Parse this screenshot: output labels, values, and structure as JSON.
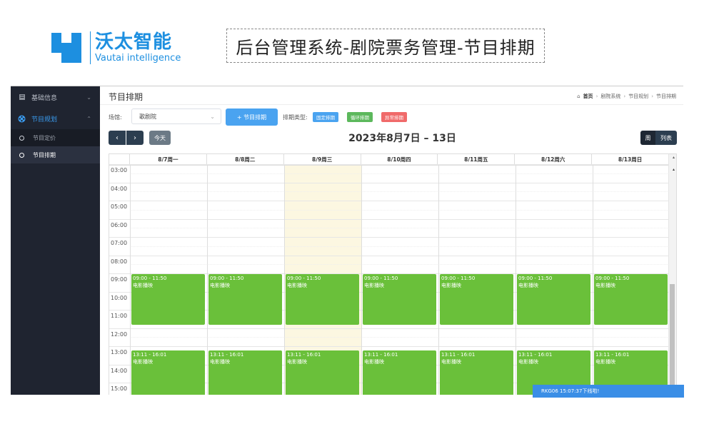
{
  "brand": {
    "title": "沃太智能",
    "subtitle": "Vautai intelligence",
    "color": "#1d8fe0"
  },
  "slide_title": "后台管理系统-剧院票务管理-节目排期",
  "sidebar": {
    "items": [
      {
        "label": "基础信息",
        "icon": "database-icon",
        "expanded": false
      },
      {
        "label": "节目规划",
        "icon": "film-reel-icon",
        "expanded": true,
        "children": [
          {
            "label": "节目定价",
            "selected": false
          },
          {
            "label": "节目排期",
            "selected": true
          }
        ]
      }
    ]
  },
  "header": {
    "page_title": "节目排期",
    "breadcrumb": [
      "首页",
      "剧院系统",
      "节目规划",
      "节目排期"
    ]
  },
  "filters": {
    "venue_label": "场馆:",
    "venue_value": "歌剧院",
    "add_button": "+ 节目排期",
    "type_label": "排期类型:",
    "types": [
      {
        "label": "固定排期",
        "color": "#4aa3f0"
      },
      {
        "label": "循环排期",
        "color": "#5cb85c"
      },
      {
        "label": "异常排期",
        "color": "#f06a6a"
      }
    ]
  },
  "toolbar": {
    "prev": "‹",
    "next": "›",
    "today": "今天",
    "range": "2023年8月7日 – 13日",
    "view_week": "周",
    "view_list": "列表"
  },
  "calendar": {
    "days": [
      "8/7周一",
      "8/8周二",
      "8/9周三",
      "8/10周四",
      "8/11周五",
      "8/12周六",
      "8/13周日"
    ],
    "today_index": 2,
    "hours": [
      "03:00",
      "04:00",
      "05:00",
      "06:00",
      "07:00",
      "08:00",
      "09:00",
      "10:00",
      "11:00",
      "12:00",
      "13:00",
      "14:00",
      "15:00"
    ],
    "events": [
      {
        "time": "09:00 - 11:50",
        "title": "电影播映",
        "start_hour": 9.0,
        "end_hour": 11.833
      },
      {
        "time": "13:11 - 16:01",
        "title": "电影播映",
        "start_hour": 13.183,
        "end_hour": 16.017
      }
    ],
    "event_color": "#6ac03a"
  },
  "toast": "RKG06 15:07:37下线啦!"
}
